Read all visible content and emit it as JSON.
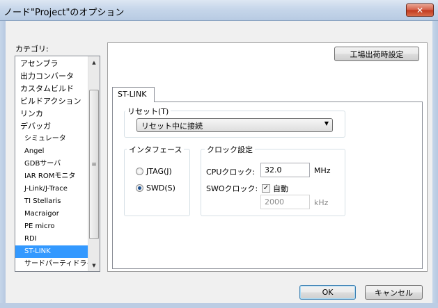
{
  "window": {
    "title": "ノード\"Project\"のオプション",
    "close_glyph": "✕"
  },
  "categories": {
    "label": "カテゴリ:",
    "items": [
      {
        "label": "アセンブラ",
        "child": false
      },
      {
        "label": "出力コンバータ",
        "child": false
      },
      {
        "label": "カスタムビルド",
        "child": false
      },
      {
        "label": "ビルドアクション",
        "child": false
      },
      {
        "label": "リンカ",
        "child": false
      },
      {
        "label": "デバッガ",
        "child": false
      },
      {
        "label": "シミュレータ",
        "child": true
      },
      {
        "label": "Angel",
        "child": true
      },
      {
        "label": "GDBサーバ",
        "child": true
      },
      {
        "label": "IAR ROMモニタ",
        "child": true
      },
      {
        "label": "J-Link/J-Trace",
        "child": true
      },
      {
        "label": "TI Stellaris",
        "child": true
      },
      {
        "label": "Macraigor",
        "child": true
      },
      {
        "label": "PE micro",
        "child": true
      },
      {
        "label": "RDI",
        "child": true
      },
      {
        "label": "ST-LINK",
        "child": true,
        "selected": true
      },
      {
        "label": "サードパーティドライ",
        "child": true
      }
    ],
    "scroll_up": "▲",
    "scroll_down": "▼",
    "scroll_grip": "≡"
  },
  "panel": {
    "factory_button": "工場出荷時設定",
    "tab_label": "ST-LINK",
    "reset": {
      "caption": "リセット(T)",
      "selected": "リセット中に接続",
      "arrow": "▼"
    },
    "interface": {
      "caption": "インタフェース",
      "options": [
        {
          "label": "JTAG(J)",
          "checked": false
        },
        {
          "label": "SWD(S)",
          "checked": true
        }
      ]
    },
    "clock": {
      "caption": "クロック設定",
      "cpu_label": "CPUクロック:",
      "cpu_value": "32.0",
      "cpu_unit": "MHz",
      "swo_label": "SWOクロック:",
      "auto_label": "自動",
      "auto_checked": true,
      "check_glyph": "✓",
      "swo_value": "2000",
      "swo_unit": "kHz"
    }
  },
  "footer": {
    "ok": "OK",
    "cancel": "キャンセル"
  }
}
